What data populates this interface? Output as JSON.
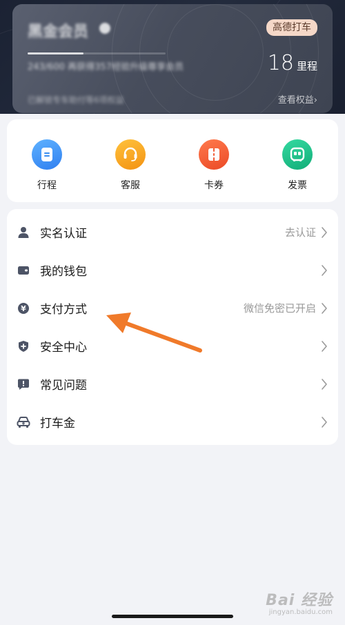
{
  "member_card": {
    "title": "黑金会员",
    "brand_badge": "高德打车",
    "progress_text": "243/600 再获得357经验升级尊享会员",
    "progress_fraction": 0.405,
    "mileage_value": "18",
    "mileage_unit": "里程",
    "subtitle": "已解锁专车助付等6项权益",
    "view_benefits": "查看权益›"
  },
  "quick_actions": [
    {
      "label": "行程",
      "icon": "itinerary-icon",
      "color": "#3a8ef0"
    },
    {
      "label": "客服",
      "icon": "customer-service-icon",
      "color": "#f6a21e"
    },
    {
      "label": "卡券",
      "icon": "coupon-icon",
      "color": "#f25a33"
    },
    {
      "label": "发票",
      "icon": "invoice-icon",
      "color": "#20c08a"
    }
  ],
  "menu": [
    {
      "label": "实名认证",
      "value": "去认证",
      "icon": "person-icon"
    },
    {
      "label": "我的钱包",
      "value": "",
      "icon": "wallet-icon"
    },
    {
      "label": "支付方式",
      "value": "微信免密已开启",
      "icon": "yuan-icon"
    },
    {
      "label": "安全中心",
      "value": "",
      "icon": "shield-icon"
    },
    {
      "label": "常见问题",
      "value": "",
      "icon": "faq-icon"
    },
    {
      "label": "打车金",
      "value": "",
      "icon": "taxi-gold-icon"
    }
  ],
  "watermark": {
    "main": "Bai 经验",
    "sub": "jingyan.baidu.com"
  },
  "colors": {
    "icon_gray": "#4d5466",
    "arrow": "#f07a2a"
  }
}
